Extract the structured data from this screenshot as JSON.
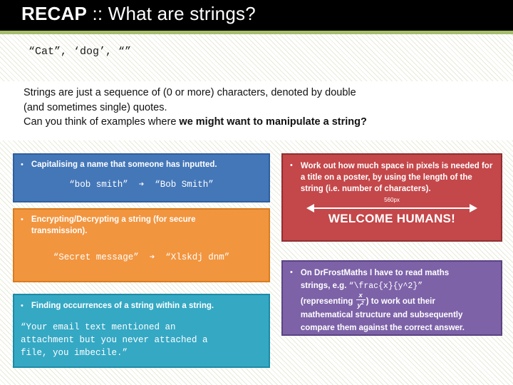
{
  "slide": {
    "title_bold": "RECAP",
    "title_rest": " :: What are strings?",
    "code_examples": "“Cat”, ‘dog’, “”",
    "paragraph_line1": "Strings are just a sequence of (0 or more) characters, denoted by double",
    "paragraph_line2": "(and sometimes single) quotes.",
    "paragraph_line3_normal": "Can you think of examples where ",
    "paragraph_line3_bold": "we might want to manipulate a string?",
    "bullet_glyph": "•",
    "colors": {
      "title_bar": "#000000",
      "green_rule": "#a6bd6b",
      "blue_box": "#4477b8",
      "orange_box": "#f2953f",
      "teal_box": "#35a8c4",
      "red_box": "#c4474a",
      "purple_box": "#7d62a8",
      "background_stripe": "#e7ead8"
    }
  },
  "boxes": {
    "capitalise": {
      "bullet": "Capitalising a name that someone has inputted.",
      "example": "“bob smith”  ➔  “Bob Smith”"
    },
    "encrypt": {
      "bullet_line1": "Encrypting/Decrypting a string (for secure",
      "bullet_line2": "transmission).",
      "example": "“Secret message”  ➔  “Xlskdj dnm”"
    },
    "find": {
      "bullet": "Finding occurrences of a string within a string.",
      "example": "“Your email text mentioned an\nattachment but you never attached a\nfile, you imbecile.”"
    },
    "length": {
      "bullet_part1": "Work out how much space in pixels is needed for a title on a poster, by using the ",
      "bullet_bold": "length",
      "bullet_part2": " of the string (i.e. number of characters).",
      "measure_label": "560px",
      "poster_text": "WELCOME HUMANS!"
    },
    "maths": {
      "line1": "On DrFrostMaths I have to read maths",
      "line2_pre": "strings, e.g. ",
      "line2_code": "“\\frac{x}{y^2}”",
      "line3_pre": "(representing ",
      "frac_numerator": "x",
      "frac_denominator": "y",
      "frac_denominator_exp": "2",
      "line3_post": ") to work out their",
      "line4": "mathematical structure and subsequently",
      "line5": "compare them against the correct answer."
    }
  }
}
